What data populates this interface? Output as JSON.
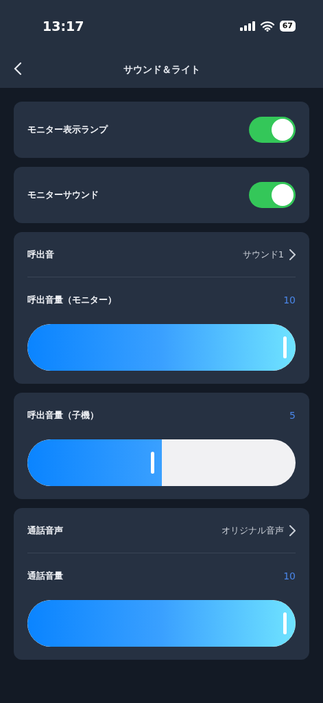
{
  "status_bar": {
    "time": "13:17",
    "battery": "67"
  },
  "nav": {
    "title": "サウンド＆ライト"
  },
  "cards": [
    {
      "items": [
        {
          "kind": "toggle",
          "label": "モニター表示ランプ",
          "on": true
        }
      ]
    },
    {
      "items": [
        {
          "kind": "toggle",
          "label": "モニターサウンド",
          "on": true
        }
      ]
    },
    {
      "items": [
        {
          "kind": "link",
          "label": "呼出音",
          "value": "サウンド1"
        },
        {
          "kind": "slider",
          "label": "呼出音量（モニター）",
          "reading": "10",
          "level": 1.0
        }
      ]
    },
    {
      "items": [
        {
          "kind": "slider",
          "label": "呼出音量（子機）",
          "reading": "5",
          "level": 0.5
        }
      ]
    },
    {
      "items": [
        {
          "kind": "link",
          "label": "通話音声",
          "value": "オリジナル音声"
        },
        {
          "kind": "slider",
          "label": "通話音量",
          "reading": "10",
          "level": 1.0
        }
      ]
    }
  ]
}
